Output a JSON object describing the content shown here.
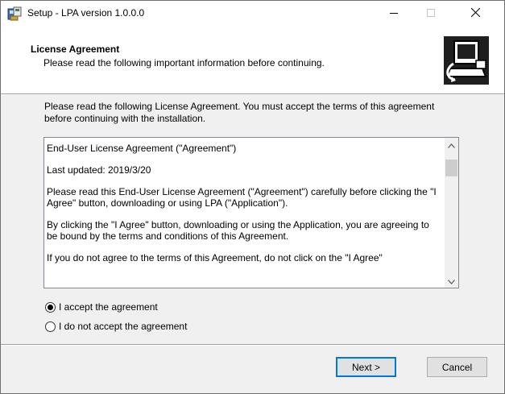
{
  "window": {
    "title": "Setup - LPA version 1.0.0.0",
    "icons": [
      "setup-app-icon",
      "minimize-icon",
      "maximize-icon",
      "close-icon"
    ]
  },
  "header": {
    "title": "License Agreement",
    "subtitle": "Please read the following important information before continuing.",
    "image": "computer-install-icon"
  },
  "intro": "Please read the following License Agreement. You must accept the terms of this agreement before continuing with the installation.",
  "license": {
    "paragraphs": [
      "End-User License Agreement (\"Agreement\")",
      "Last updated: 2019/3/20",
      "Please read this End-User License Agreement (\"Agreement\") carefully before clicking the \"I Agree\" button, downloading or using LPA (\"Application\").",
      "By clicking the \"I Agree\" button, downloading or using the Application, you are agreeing to be bound by the terms and conditions of this Agreement.",
      "If you do not agree to the terms of this Agreement, do not click on the \"I Agree\""
    ]
  },
  "options": {
    "accept": "I accept the agreement",
    "decline": "I do not accept the agreement",
    "selected": "accept"
  },
  "buttons": {
    "next": "Next >",
    "cancel": "Cancel"
  },
  "colors": {
    "focus_border": "#0078d7",
    "window_bg": "#f0f0f0"
  }
}
